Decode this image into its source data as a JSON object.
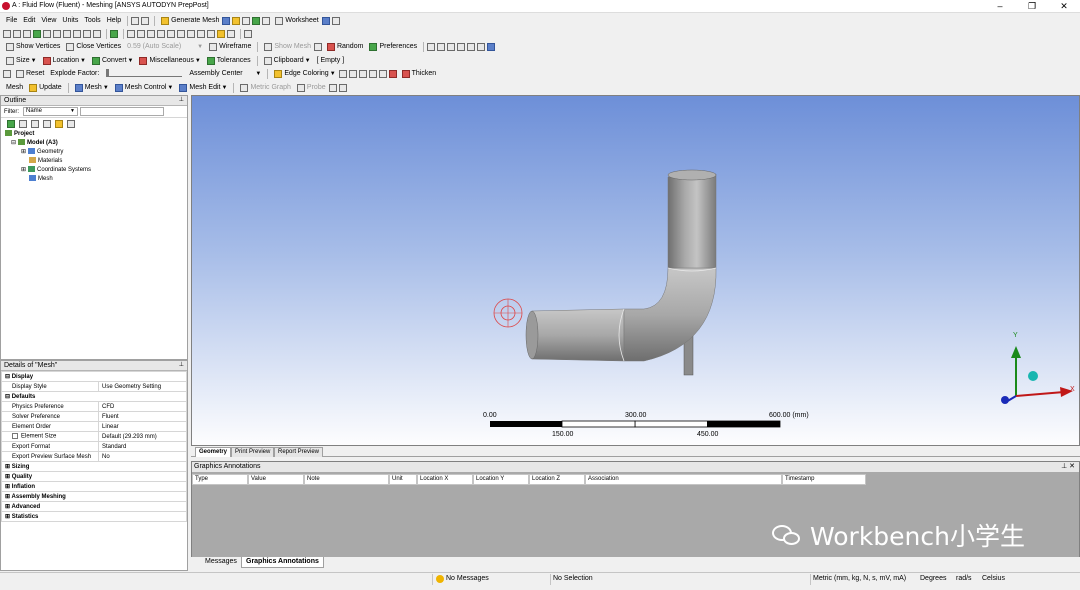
{
  "window": {
    "title": "A : Fluid Flow (Fluent) - Meshing [ANSYS AUTODYN PrepPost]",
    "minimize": "–",
    "maximize": "❐",
    "close": "✕"
  },
  "menu": [
    "File",
    "Edit",
    "View",
    "Units",
    "Tools",
    "Help"
  ],
  "toolbar1": {
    "generate_mesh": "Generate Mesh",
    "worksheet": "Worksheet"
  },
  "toolbar2": {
    "show_vertices": "Show Vertices",
    "close_vertices": "Close Vertices",
    "auto_scale": "0.59 (Auto Scale)",
    "wireframe": "Wireframe",
    "show_mesh": "Show Mesh",
    "random": "Random",
    "preferences": "Preferences"
  },
  "toolbar3": {
    "size": "Size",
    "location": "Location",
    "convert": "Convert",
    "miscellaneous": "Miscellaneous",
    "tolerances": "Tolerances",
    "clipboard": "Clipboard",
    "empty": "[ Empty ]"
  },
  "toolbar4": {
    "reset": "Reset",
    "explode_factor": "Explode Factor:",
    "assembly_center": "Assembly Center",
    "edge_coloring": "Edge Coloring",
    "thicken": "Thicken"
  },
  "toolbar5": {
    "mesh": "Mesh",
    "update": "Update",
    "mesh_dd": "Mesh",
    "mesh_control": "Mesh Control",
    "mesh_edit": "Mesh Edit",
    "metric_graph": "Metric Graph",
    "probe": "Probe"
  },
  "outline": {
    "title": "Outline",
    "filter_label": "Filter:",
    "filter_value": "Name",
    "tree": {
      "project": "Project",
      "model": "Model (A3)",
      "geometry": "Geometry",
      "materials": "Materials",
      "coordinate_systems": "Coordinate Systems",
      "mesh": "Mesh"
    }
  },
  "details": {
    "title": "Details of \"Mesh\"",
    "display_group": "Display",
    "display_style_label": "Display Style",
    "display_style_value": "Use Geometry Setting",
    "defaults_group": "Defaults",
    "physics_pref_label": "Physics Preference",
    "physics_pref_value": "CFD",
    "solver_pref_label": "Solver Preference",
    "solver_pref_value": "Fluent",
    "element_order_label": "Element Order",
    "element_order_value": "Linear",
    "element_size_label": "Element Size",
    "element_size_value": "Default (29.293 mm)",
    "export_format_label": "Export Format",
    "export_format_value": "Standard",
    "export_preview_label": "Export Preview Surface Mesh",
    "export_preview_value": "No",
    "sizing": "Sizing",
    "quality": "Quality",
    "inflation": "Inflation",
    "assembly_meshing": "Assembly Meshing",
    "advanced": "Advanced",
    "statistics": "Statistics"
  },
  "scale": {
    "t0": "0.00",
    "t1": "300.00",
    "t2": "600.00 (mm)",
    "t3": "150.00",
    "t4": "450.00"
  },
  "triad": {
    "x": "X",
    "y": "Y"
  },
  "view_tabs": {
    "geometry": "Geometry",
    "print_preview": "Print Preview",
    "report_preview": "Report Preview"
  },
  "annotations": {
    "title": "Graphics Annotations",
    "columns": [
      "Type",
      "Value",
      "Note",
      "Unit",
      "Location X",
      "Location Y",
      "Location Z",
      "Association",
      "Timestamp"
    ]
  },
  "bottom_tabs": {
    "messages": "Messages",
    "graphics_annotations": "Graphics Annotations"
  },
  "status": {
    "no_messages": "No Messages",
    "no_selection": "No Selection",
    "units": "Metric (mm, kg, N, s, mV, mA)",
    "degrees": "Degrees",
    "rads": "rad/s",
    "celsius": "Celsius"
  },
  "watermark": "Workbench小学生"
}
